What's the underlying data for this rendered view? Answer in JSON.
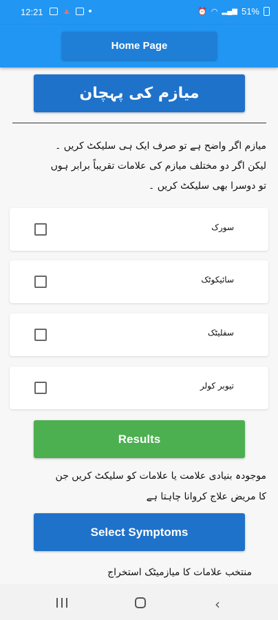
{
  "status_bar": {
    "time": "12:21",
    "battery": "51%",
    "left_icons": [
      "image-icon",
      "warning-icon",
      "youtube-icon",
      "dot-icon"
    ],
    "right_icons": [
      "alarm-icon",
      "wifi-icon",
      "signal-icon",
      "signal-icon",
      "battery-icon"
    ]
  },
  "app_bar": {
    "home_label": "Home Page"
  },
  "title_button": "میازم کی پہچان",
  "instructions": [
    "میازم اگر واضح ہے تو صرف ایک ہی سلیکٹ کریں ۔",
    "لیکن اگر دو مختلف میازم کی علامات تقریباً برابر ہوں",
    "تو دوسرا بھی سلیکٹ کریں ۔"
  ],
  "miasms": [
    {
      "label": "سورک",
      "checked": false
    },
    {
      "label": "سائیکوٹک",
      "checked": false
    },
    {
      "label": "سفلیٹک",
      "checked": false
    },
    {
      "label": "تیوبر کولر",
      "checked": false
    }
  ],
  "results_label": "Results",
  "select_instruction": [
    "موجودہ بنیادی علامت یا علامات کو سلیکٹ کریں جن",
    "کا مریض علاج کروانا چاہتا ہے"
  ],
  "select_symptoms_label": "Select Symptoms",
  "extract_text": "منتخب علامات کا میازمیٹک استخراج",
  "nav_bar": {
    "icons": [
      "recent-apps-icon",
      "home-icon",
      "back-icon"
    ]
  }
}
